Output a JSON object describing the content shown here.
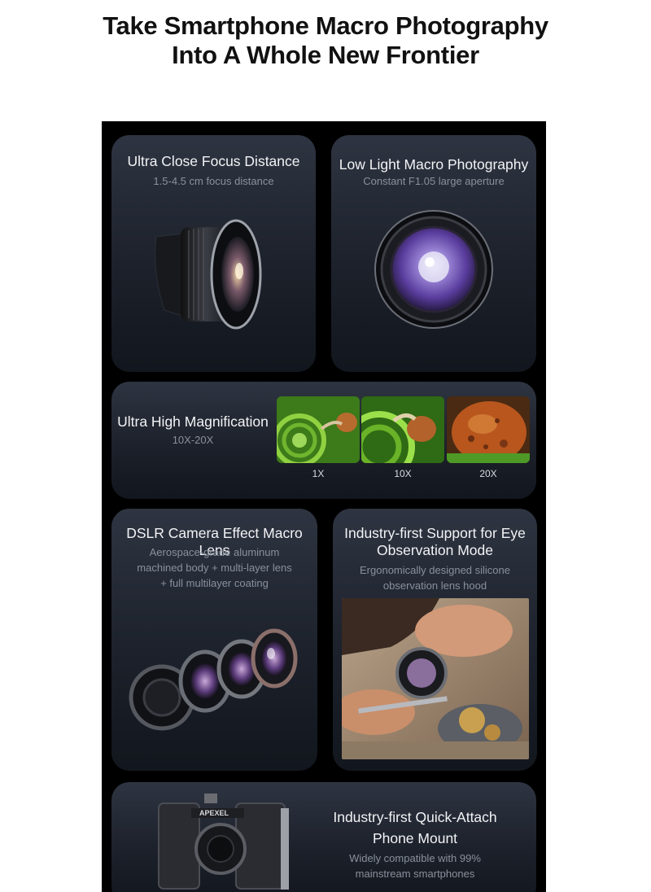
{
  "headline": {
    "line1": "Take Smartphone Macro Photography",
    "line2": "Into A Whole New Frontier"
  },
  "cards": {
    "focus": {
      "title": "Ultra Close Focus Distance",
      "subtitle": "1.5-4.5 cm focus distance"
    },
    "lowlight": {
      "title": "Low Light Macro Photography",
      "subtitle": "Constant F1.05 large aperture"
    },
    "magnification": {
      "title": "Ultra High Magnification",
      "subtitle": "10X-20X",
      "levels": [
        "1X",
        "10X",
        "20X"
      ]
    },
    "dslr": {
      "title": "DSLR Camera Effect Macro Lens",
      "subtitle_lines": [
        "Aerospace-grade aluminum",
        "machined body + multi-layer lens",
        "+ full multilayer coating"
      ]
    },
    "eye": {
      "title_lines": [
        "Industry-first Support for Eye",
        "Observation Mode"
      ],
      "subtitle_lines": [
        "Ergonomically designed silicone",
        "observation lens hood"
      ]
    },
    "mount": {
      "brand": "APEXEL",
      "title_lines": [
        "Industry-first Quick-Attach",
        "Phone Mount"
      ],
      "subtitle_lines": [
        "Widely compatible with 99%",
        "mainstream smartphones"
      ]
    }
  },
  "colors": {
    "accent_purple": "#6b4fb5",
    "card_top": "#2e3441",
    "card_bottom": "#12161d",
    "snail_green": "#5fae2a"
  }
}
